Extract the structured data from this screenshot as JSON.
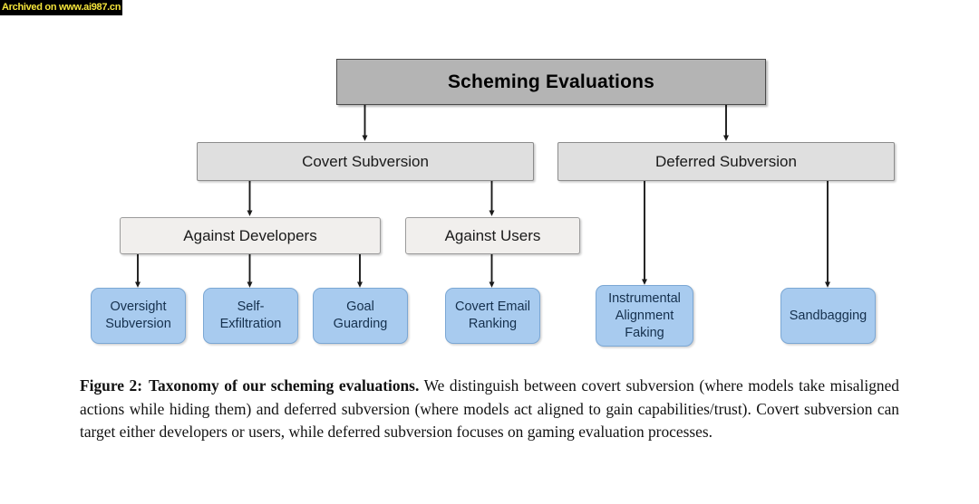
{
  "watermark": {
    "text": "Archived on www.ai987.cn",
    "text_color": "#f5e53b",
    "background_color": "#000000"
  },
  "figure": {
    "title": "Taxonomy of our scheming evaluations.",
    "caption_label": "Figure 2:",
    "caption_body": " We distinguish between covert subversion (where models take misaligned actions while hiding them) and deferred subversion (where models act aligned to gain capabilities/trust). Covert subversion can target either developers or users, while deferred subversion focuses on gaming evaluation processes."
  },
  "colors": {
    "root_fill": "#b4b4b4",
    "level1_fill": "#dfdfdf",
    "level2_fill": "#f1efed",
    "leaf_fill": "#a8cbef",
    "leaf_border": "#7ba7d4",
    "leaf_text": "#15304d",
    "connector": "#1a1a1a"
  },
  "diagram": {
    "type": "tree",
    "orientation": "top-down",
    "root": {
      "label": "Scheming Evaluations"
    },
    "level1": [
      {
        "label": "Covert Subversion"
      },
      {
        "label": "Deferred Subversion"
      }
    ],
    "level2": [
      {
        "label": "Against Developers",
        "parent": "Covert Subversion"
      },
      {
        "label": "Against Users",
        "parent": "Covert Subversion"
      }
    ],
    "leaves": [
      {
        "label": "Oversight\nSubversion",
        "parent": "Against Developers"
      },
      {
        "label": "Self-\nExfiltration",
        "parent": "Against Developers"
      },
      {
        "label": "Goal\nGuarding",
        "parent": "Against Developers"
      },
      {
        "label": "Covert Email\nRanking",
        "parent": "Against Users"
      },
      {
        "label": "Instrumental\nAlignment\nFaking",
        "parent": "Deferred Subversion"
      },
      {
        "label": "Sandbagging",
        "parent": "Deferred Subversion"
      }
    ]
  }
}
